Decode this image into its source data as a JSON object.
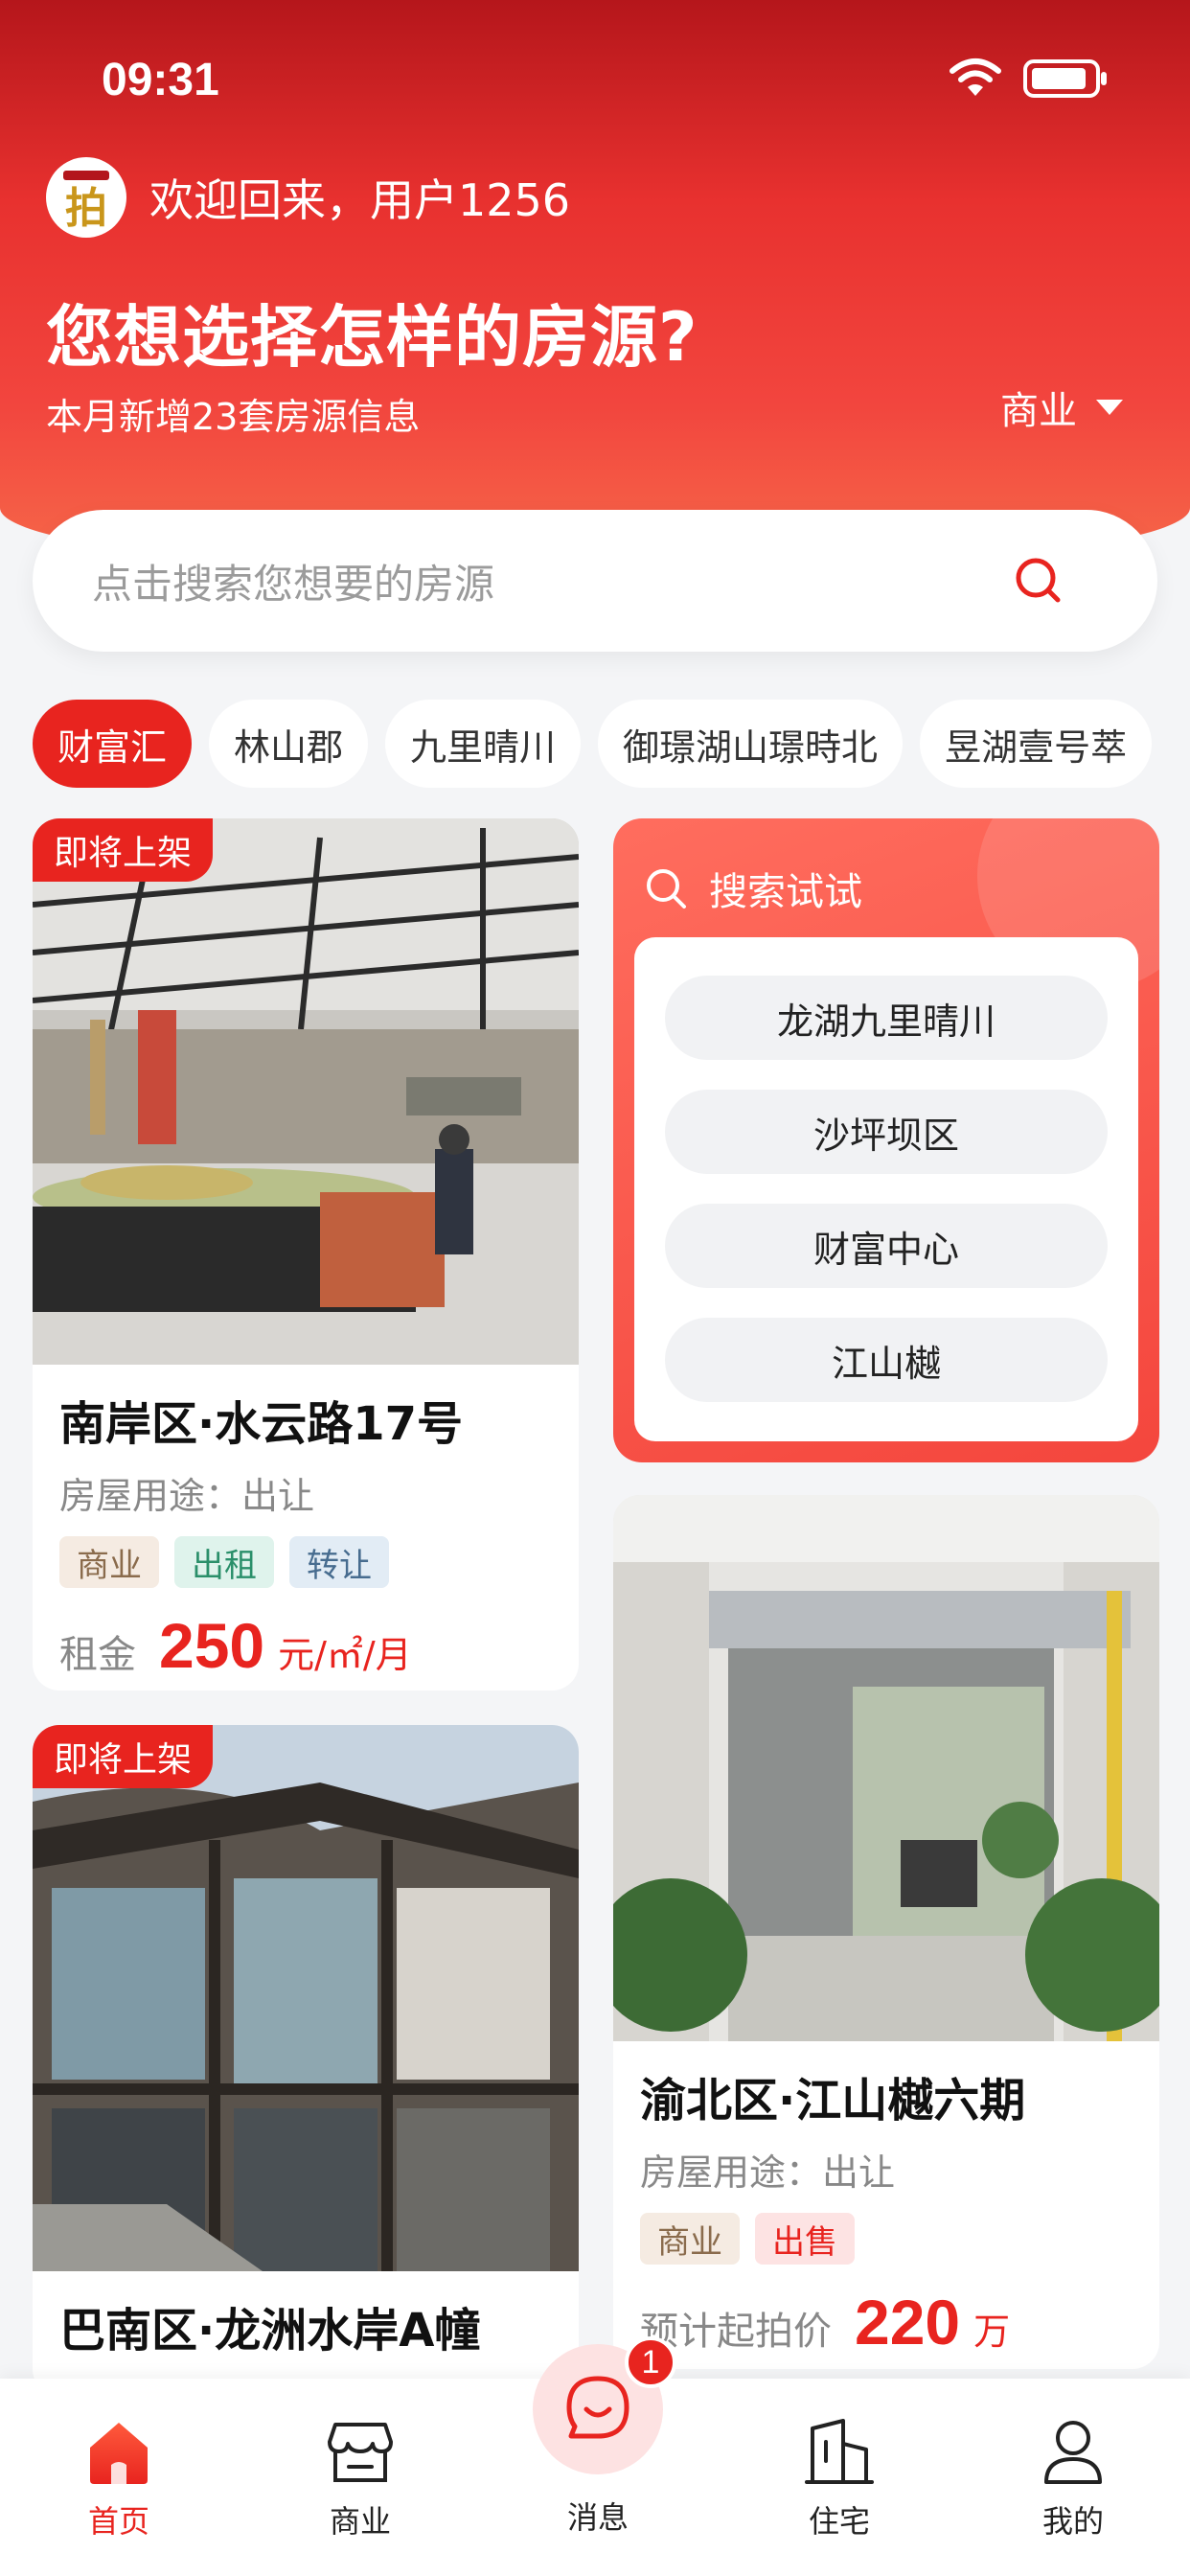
{
  "status_bar": {
    "time": "09:31"
  },
  "header": {
    "welcome": "欢迎回来，用户1256",
    "avatar_char": "拍",
    "headline": "您想选择怎样的房源?",
    "subline": "本月新增23套房源信息",
    "category": "商业"
  },
  "search": {
    "placeholder": "点击搜索您想要的房源"
  },
  "chips": [
    "财富汇",
    "林山郡",
    "九里晴川",
    "御璟湖山璟時北",
    "昱湖壹号萃"
  ],
  "cards": [
    {
      "badge": "即将上架",
      "title": "南岸区·水云路17号",
      "usage": "房屋用途：出让",
      "tags": [
        "商业",
        "出租",
        "转让"
      ],
      "price_label": "租金",
      "price": "250",
      "unit": "元/㎡/月"
    },
    {
      "badge": "即将上架",
      "title": "巴南区·龙洲水岸A幢"
    },
    {
      "title": "渝北区·江山樾六期",
      "usage": "房屋用途：出让",
      "tags": [
        "商业",
        "出售"
      ],
      "price_label": "预计起拍价",
      "price": "220",
      "unit": "万"
    }
  ],
  "try_search": {
    "title": "搜索试试",
    "items": [
      "龙湖九里晴川",
      "沙坪坝区",
      "财富中心",
      "江山樾"
    ]
  },
  "nav": {
    "home": "首页",
    "business": "商业",
    "message": "消息",
    "message_badge": "1",
    "residential": "住宅",
    "mine": "我的"
  },
  "colors": {
    "accent": "#e8241f",
    "header_top": "#b5161b",
    "header_bottom": "#f66a4a"
  }
}
